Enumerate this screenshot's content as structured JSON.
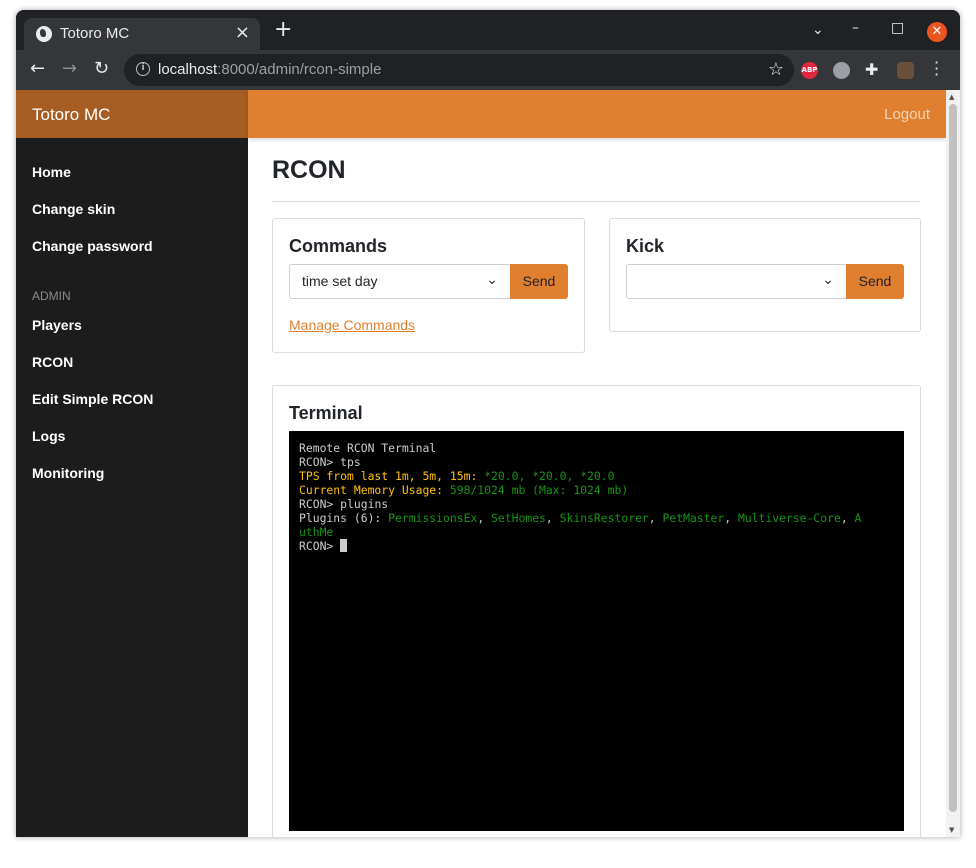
{
  "browser": {
    "tab_title": "Totoro MC",
    "url_host": "localhost",
    "url_path": ":8000/admin/rcon-simple",
    "extension_abp": "ABP"
  },
  "app": {
    "brand": "Totoro MC",
    "logout": "Logout",
    "accent_color": "#e07f30"
  },
  "sidebar": {
    "items": [
      "Home",
      "Change skin",
      "Change password"
    ],
    "admin_heading": "ADMIN",
    "admin_items": [
      "Players",
      "RCON",
      "Edit Simple RCON",
      "Logs",
      "Monitoring"
    ]
  },
  "main": {
    "title": "RCON",
    "commands": {
      "title": "Commands",
      "selected": "time set day",
      "send": "Send",
      "manage_link": "Manage Commands"
    },
    "kick": {
      "title": "Kick",
      "selected": "",
      "send": "Send"
    },
    "terminal": {
      "title": "Terminal",
      "header": "Remote RCON Terminal",
      "prompt": "RCON>",
      "cmd1": " tps",
      "tps_label": "TPS from last 1m, 5m, 15m:",
      "tps_value": " *20.0, *20.0, *20.0",
      "mem_label": "Current Memory Usage:",
      "mem_value": " 598/1024 mb (Max: 1024 mb)",
      "cmd2": " plugins",
      "plugins_label": "Plugins (6): ",
      "plugins": [
        "PermissionsEx",
        "SetHomes",
        "SkinsRestorer",
        "PetMaster",
        "Multiverse-Core",
        "AuthMe"
      ],
      "plugins_wrap_head": "A",
      "plugins_wrap_tail": "uthMe"
    }
  }
}
